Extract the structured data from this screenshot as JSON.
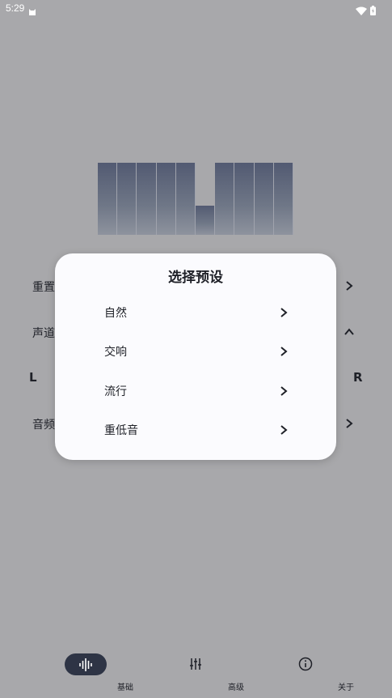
{
  "status_bar": {
    "time": "5:29",
    "icons": [
      "cat-icon",
      "wifi-icon",
      "battery-icon"
    ]
  },
  "equalizer": {
    "levels": [
      1,
      1,
      1,
      1,
      1,
      0.4,
      1,
      1,
      1,
      1
    ]
  },
  "background_rows": {
    "reset_label": "重置",
    "channel_label": "声道",
    "left_label": "L",
    "right_label": "R",
    "audio_label": "音频"
  },
  "dialog": {
    "title": "选择预设",
    "presets": [
      {
        "label": "自然"
      },
      {
        "label": "交响"
      },
      {
        "label": "流行"
      },
      {
        "label": "重低音"
      }
    ]
  },
  "bottom_nav": {
    "items": [
      {
        "label": "基础",
        "icon": "waveform-icon",
        "active": true
      },
      {
        "label": "高级",
        "icon": "sliders-icon",
        "active": false
      },
      {
        "label": "关于",
        "icon": "info-icon",
        "active": false
      }
    ]
  },
  "colors": {
    "scrim_background": "#a8a8ab",
    "dialog_background": "#fbfbfe",
    "active_pill": "#2e3445",
    "text": "#1f2128"
  }
}
